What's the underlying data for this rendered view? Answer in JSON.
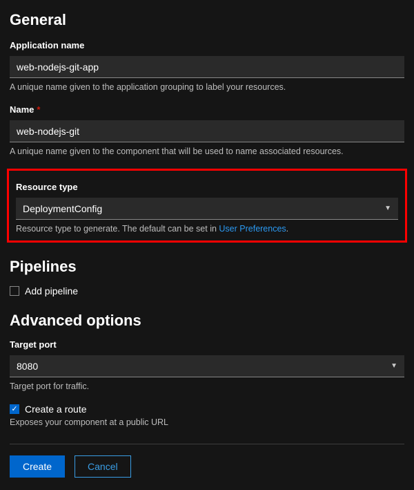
{
  "general": {
    "title": "General",
    "app_name_label": "Application name",
    "app_name_value": "web-nodejs-git-app",
    "app_name_help": "A unique name given to the application grouping to label your resources.",
    "name_label": "Name",
    "name_value": "web-nodejs-git",
    "name_help": "A unique name given to the component that will be used to name associated resources.",
    "resource_type_label": "Resource type",
    "resource_type_value": "DeploymentConfig",
    "resource_type_help_prefix": "Resource type to generate. The default can be set in ",
    "resource_type_help_link": "User Preferences",
    "resource_type_help_suffix": "."
  },
  "pipelines": {
    "title": "Pipelines",
    "add_pipeline_label": "Add pipeline",
    "add_pipeline_checked": false
  },
  "advanced": {
    "title": "Advanced options",
    "target_port_label": "Target port",
    "target_port_value": "8080",
    "target_port_help": "Target port for traffic.",
    "create_route_label": "Create a route",
    "create_route_checked": true,
    "create_route_help": "Exposes your component at a public URL"
  },
  "buttons": {
    "create": "Create",
    "cancel": "Cancel"
  }
}
